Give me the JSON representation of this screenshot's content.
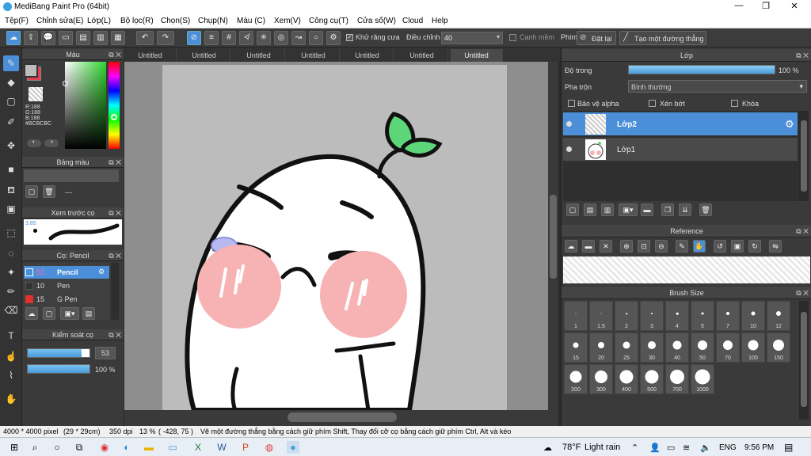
{
  "window": {
    "title": "MediBang Paint Pro (64bit)"
  },
  "menu": [
    "Tệp(F)",
    "Chỉnh sửa(E)",
    "Lớp(L)",
    "Bộ lọc(R)",
    "Chọn(S)",
    "Chụp(N)",
    "Màu (C)",
    "Xem(V)",
    "Công cụ(T)",
    "Cửa số(W)",
    "Cloud",
    "Help"
  ],
  "toolbar": {
    "antialias_label": "Khử răng cưa",
    "adjust_label": "Điều chỉnh",
    "adjust_value": "40",
    "soft_edge_label": "Cạnh mềm",
    "key_label": "Phím",
    "reset_label": "Đặt lại",
    "straight_line_label": "Tạo một đường thẳng"
  },
  "color_panel": {
    "title": "Màu",
    "r": "R:188",
    "g": "G:188",
    "b": "B:188",
    "hex": "#BCBCBC",
    "current_color": "#bcbcbc",
    "secondary_color": "#e04050"
  },
  "palette_panel": {
    "title": "Bảng màu",
    "value": "---"
  },
  "brush_preview_panel": {
    "title": "Xem trước cọ",
    "size": "3.85"
  },
  "brush_panel": {
    "title": "Cọ: Pencil",
    "items": [
      {
        "size": "53",
        "name": "Pencil",
        "color": "#4a8fd8"
      },
      {
        "size": "10",
        "name": "Pen",
        "color": "#333333"
      },
      {
        "size": "15",
        "name": "G Pen",
        "color": "#e03030"
      }
    ]
  },
  "brush_control_panel": {
    "title": "Kiểm soát cọ",
    "size_value": "53",
    "opacity_value": "100 %",
    "size_fill": 0.87,
    "opacity_fill": 1.0
  },
  "tabs": [
    "Untitled",
    "Untitled",
    "Untitled",
    "Untitled",
    "Untitled",
    "Untitled",
    "Untitled"
  ],
  "layer_panel": {
    "title": "Lớp",
    "opacity_label": "Độ trong",
    "opacity_value": "100 %",
    "blend_label": "Pha trộn",
    "blend_value": "Bình thường",
    "protect_alpha": "Bảo vệ alpha",
    "clipping": "Xén bớt",
    "lock": "Khóa",
    "layers": [
      {
        "name": "Lớp2",
        "active": true
      },
      {
        "name": "Lớp1",
        "active": false
      }
    ]
  },
  "reference_panel": {
    "title": "Reference"
  },
  "brush_size_panel": {
    "title": "Brush Size",
    "sizes": [
      "1",
      "1.5",
      "2",
      "3",
      "4",
      "5",
      "7",
      "10",
      "12",
      "15",
      "20",
      "25",
      "30",
      "40",
      "50",
      "70",
      "100",
      "150",
      "200",
      "300",
      "400",
      "500",
      "700",
      "1000"
    ]
  },
  "status": {
    "dimensions": "4000 * 4000 pixel",
    "size_cm": "(29 * 29cm)",
    "dpi": "350 dpi",
    "zoom": "13 %",
    "coords": "( -428, 75 )",
    "hint": "Vẽ một đường thẳng bằng cách giữ phím Shift, Thay đổi cỡ cọ bằng cách giữ phím Ctrl, Alt và kéo"
  },
  "taskbar": {
    "weather_temp": "78°F",
    "weather_desc": "Light rain",
    "lang": "ENG",
    "time": "9:56 PM"
  }
}
